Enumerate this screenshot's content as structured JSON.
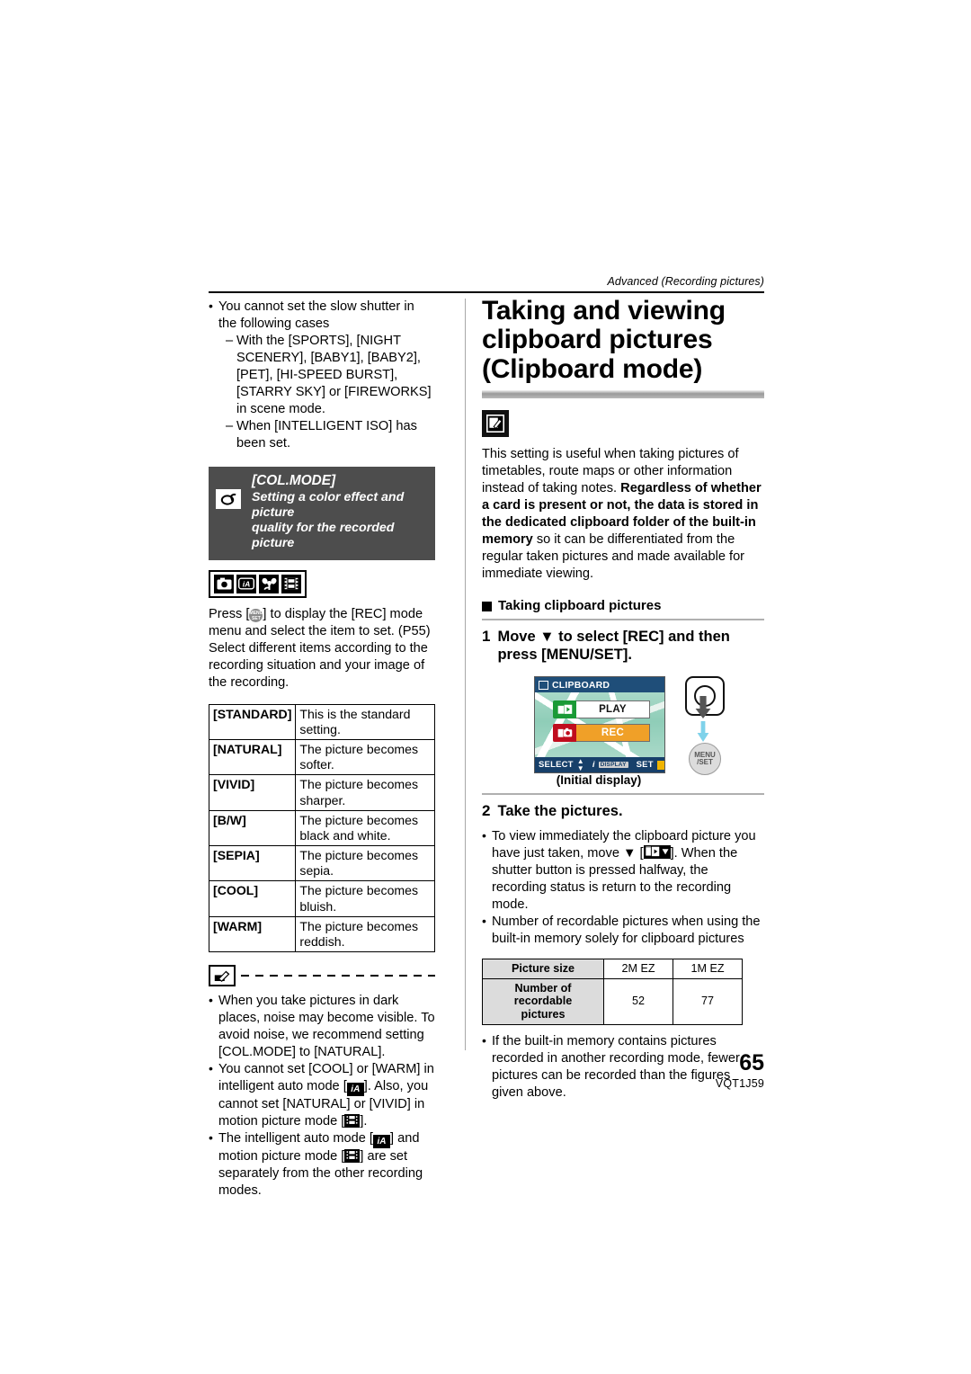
{
  "running_head": "Advanced (Recording pictures)",
  "left_column": {
    "intro_bullet": "You cannot set the slow shutter in the following cases",
    "dash_items": [
      "With the [SPORTS], [NIGHT SCENERY], [BABY1], [BABY2], [PET], [HI-SPEED BURST], [STARRY SKY] or [FIREWORKS] in scene mode.",
      "When [INTELLIGENT ISO] has been set."
    ],
    "banner": {
      "icon": "color-mode-icon",
      "title": "[COL.MODE]",
      "subtitle_line1": "Setting a color effect and picture",
      "subtitle_line2": "quality for the recorded picture"
    },
    "mode_icons": [
      "rec-mode-icon",
      "intelligent-auto-icon",
      "macro-mode-icon",
      "motion-picture-icon"
    ],
    "press_paragraph_pre": "Press [",
    "press_paragraph_post": "] to display the [REC] mode menu and select the item to set. (P55) Select different items according to the recording situation and your image of the recording.",
    "color_table": {
      "rows": [
        {
          "key": "[STANDARD]",
          "desc": "This is the standard setting."
        },
        {
          "key": "[NATURAL]",
          "desc": "The picture becomes softer."
        },
        {
          "key": "[VIVID]",
          "desc": "The picture becomes sharper."
        },
        {
          "key": "[B/W]",
          "desc": "The picture becomes black and white."
        },
        {
          "key": "[SEPIA]",
          "desc": "The picture becomes sepia."
        },
        {
          "key": "[COOL]",
          "desc": "The picture becomes bluish."
        },
        {
          "key": "[WARM]",
          "desc": "The picture becomes reddish."
        }
      ]
    },
    "notes": {
      "note1": "When you take pictures in dark places, noise may become visible. To avoid noise, we recommend setting [COL.MODE] to [NATURAL].",
      "note2_a": "You cannot set [COOL] or [WARM] in intelligent auto mode [",
      "note2_b": "]. Also, you cannot set [NATURAL] or [VIVID] in motion picture mode [",
      "note2_c": "].",
      "note3_a": "The intelligent auto mode [",
      "note3_b": "] and motion picture mode [",
      "note3_c": "] are set separately from the other recording modes."
    }
  },
  "right_column": {
    "title_lines": [
      "Taking and viewing",
      "clipboard pictures",
      "(Clipboard mode)"
    ],
    "mode_icon": "clipboard-mode-icon",
    "intro_normal_1": "This setting is useful when taking pictures of timetables, route maps or other information instead of taking notes. ",
    "intro_bold": "Regardless of whether a card is present or not, the data is stored in the dedicated clipboard folder of the built-in memory",
    "intro_normal_2": " so it can be differentiated from the regular taken pictures and made available for immediate viewing.",
    "section_heading": "Taking clipboard pictures",
    "step1_number": "1",
    "step1_text": "Move ▼ to select [REC] and then press [MENU/SET].",
    "figure": {
      "lcd_title": "CLIPBOARD",
      "row_play": "PLAY",
      "row_rec": "REC",
      "status_select": "SELECT",
      "status_display": "DISPLAY",
      "status_set": "SET",
      "caption": "(Initial display)",
      "menu_button_line1": "MENU",
      "menu_button_line2": "/SET"
    },
    "step2_number": "2",
    "step2_text": "Take the pictures.",
    "bullets": {
      "b1_a": "To view immediately the clipboard picture you have just taken, move ▼ [",
      "b1_b": "]. When the shutter button is pressed halfway, the recording status is return to the recording mode.",
      "b2": "Number of recordable pictures when using the built-in memory solely for clipboard pictures",
      "b3": "If the built-in memory contains pictures recorded in another recording mode, fewer pictures can be recorded than the figures given above."
    },
    "recordable_table": {
      "header_label": "Picture size",
      "sizes": [
        "2M EZ",
        "1M EZ"
      ],
      "row_label_line1": "Number of recordable",
      "row_label_line2": "pictures",
      "counts": [
        "52",
        "77"
      ]
    }
  },
  "footer": {
    "page_number": "65",
    "doc_code": "VQT1J59"
  }
}
